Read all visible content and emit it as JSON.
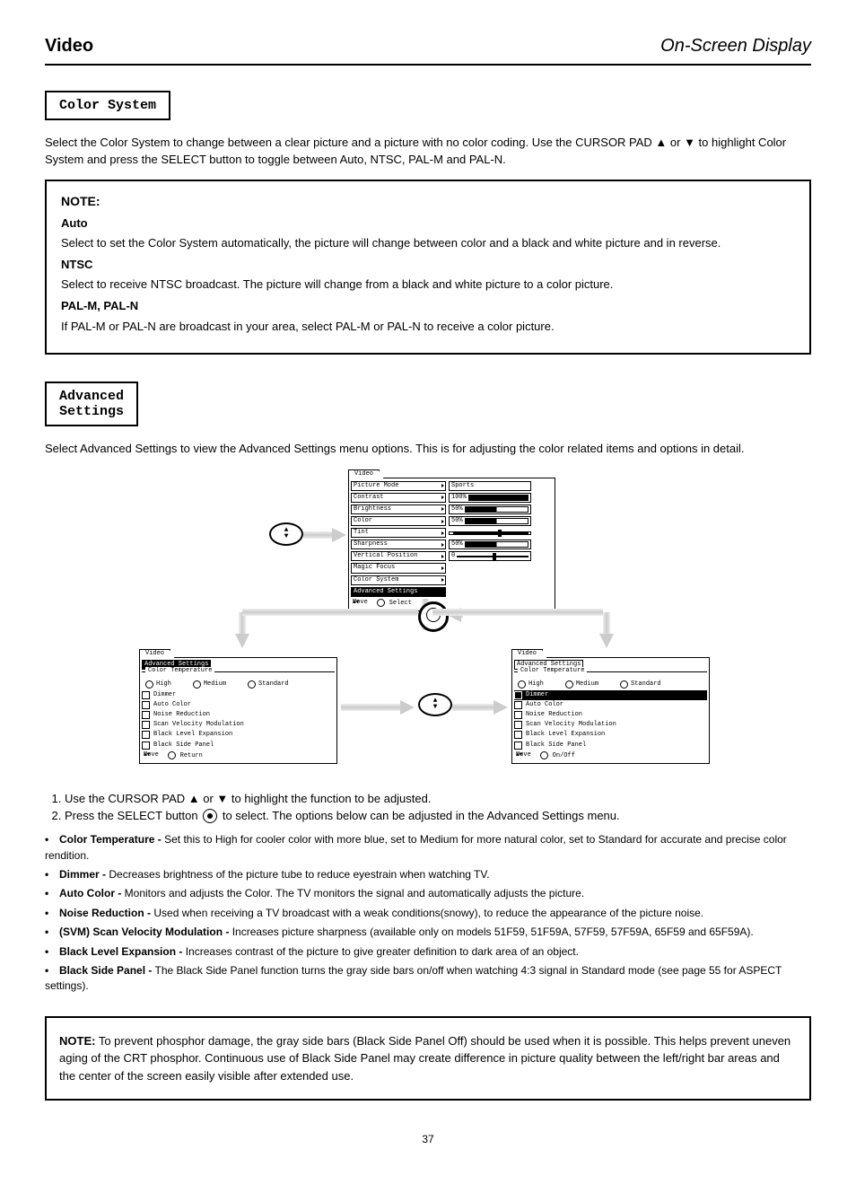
{
  "header": {
    "left": "Video",
    "right": "On-Screen Display"
  },
  "sections": {
    "color_system": {
      "label": "Color System",
      "para": "Select the Color System to change between a clear picture and a picture with no color coding. Use the CURSOR PAD ▲ or ▼ to highlight Color System and press the SELECT button to toggle between Auto, NTSC, PAL-M and PAL-N."
    },
    "note1": {
      "title": "NOTE:",
      "items": [
        {
          "sub": "Auto",
          "text": "Select to set the Color System automatically, the picture will change between color and a black and white picture and in reverse."
        },
        {
          "sub": "NTSC",
          "text": "Select to receive NTSC broadcast. The picture will change from a black and white picture to a color picture."
        },
        {
          "sub": "PAL-M, PAL-N",
          "text": "If PAL-M or PAL-N are broadcast in your area, select PAL-M or PAL-N to receive a color picture."
        }
      ]
    },
    "advanced": {
      "label": "Advanced\nSettings",
      "intro": "Select Advanced Settings to view the Advanced Settings menu options. This is for adjusting the color related items and options in detail.",
      "steps": [
        "Use the CURSOR PAD ▲ or ▼ to highlight the function to be adjusted.",
        "Press the SELECT button {sel} to select. The options below can be adjusted in the Advanced Settings menu."
      ],
      "items": [
        {
          "name": "Color Temperature",
          "desc": "Set this to High for cooler color with more blue, set to Medium for more natural color, set to Standard for accurate and precise color rendition."
        },
        {
          "name": "Dimmer",
          "desc": "Decreases brightness of the picture tube to reduce eyestrain when watching TV."
        },
        {
          "name": "Auto Color",
          "desc": "Monitors and adjusts the Color.  The TV monitors the signal and automatically adjusts the picture."
        },
        {
          "name": "Noise Reduction",
          "desc": "Used when receiving a TV broadcast with a weak conditions(snowy), to reduce the appearance of the picture noise."
        },
        {
          "name": "(SVM) Scan Velocity Modulation",
          "desc": " Increases picture sharpness (available only on models 51F59, 51F59A, 57F59, 57F59A, 65F59 and 65F59A)."
        },
        {
          "name": "Black Level Expansion",
          "desc": "Increases contrast of the picture to give greater definition to dark area of an object."
        },
        {
          "name": "Black Side Panel",
          "desc": "The Black Side Panel function turns the gray side bars on/off when watching 4:3 signal in Standard mode (see page 55 for ASPECT settings)."
        }
      ]
    },
    "note2": {
      "title": "NOTE:",
      "text": "To prevent phosphor damage, the gray side bars (Black Side Panel Off) should be used when it is possible. This helps prevent uneven aging of the CRT phosphor. Continuous use of Black Side Panel may create difference in picture quality between the left/right bar areas and the center of the screen easily visible after extended use."
    }
  },
  "diagram": {
    "main_menu": {
      "tab": "Video",
      "rows": [
        {
          "label": "Picture Mode",
          "value_label": "Sports",
          "type": "label"
        },
        {
          "label": "Contrast",
          "value": "100%",
          "type": "bar",
          "fill": "100%"
        },
        {
          "label": "Brightness",
          "value": "50%",
          "type": "bar",
          "fill": "50%"
        },
        {
          "label": "Color",
          "value": "50%",
          "type": "bar",
          "fill": "50%"
        },
        {
          "label": "Tint",
          "value": "",
          "type": "slider",
          "pos": "60%"
        },
        {
          "label": "Sharpness",
          "value": "50%",
          "type": "bar",
          "fill": "50%"
        },
        {
          "label": "Vertical Position",
          "value": "0",
          "type": "slider",
          "pos": "50%"
        },
        {
          "label": "Magic Focus",
          "type": "none"
        },
        {
          "label": "Color System",
          "type": "none"
        },
        {
          "label": "Advanced Settings",
          "type": "none",
          "highlight": true
        }
      ],
      "hint_move": "Move",
      "hint_select": "Select"
    },
    "sub_menu_left": {
      "tab": "Video",
      "subtab": "Advanced Settings",
      "subtab_highlight": true,
      "fieldset": "Color Temperature",
      "radios": [
        "High",
        "Medium",
        "Standard"
      ],
      "checks": [
        "Dimmer",
        "Auto Color",
        "Noise Reduction",
        "Scan Velocity Modulation",
        "Black Level Expansion",
        "Black Side Panel"
      ],
      "highlight": "",
      "hint_move": "Move",
      "hint_action": "Return"
    },
    "sub_menu_right": {
      "tab": "Video",
      "subtab": "Advanced Settings",
      "subtab_highlight": false,
      "fieldset": "Color Temperature",
      "radios": [
        "High",
        "Medium",
        "Standard"
      ],
      "checks": [
        "Dimmer",
        "Auto Color",
        "Noise Reduction",
        "Scan Velocity Modulation",
        "Black Level Expansion",
        "Black Side Panel"
      ],
      "highlight": "Dimmer",
      "hint_move": "Move",
      "hint_action": "On/Off"
    }
  },
  "page_number": "37"
}
